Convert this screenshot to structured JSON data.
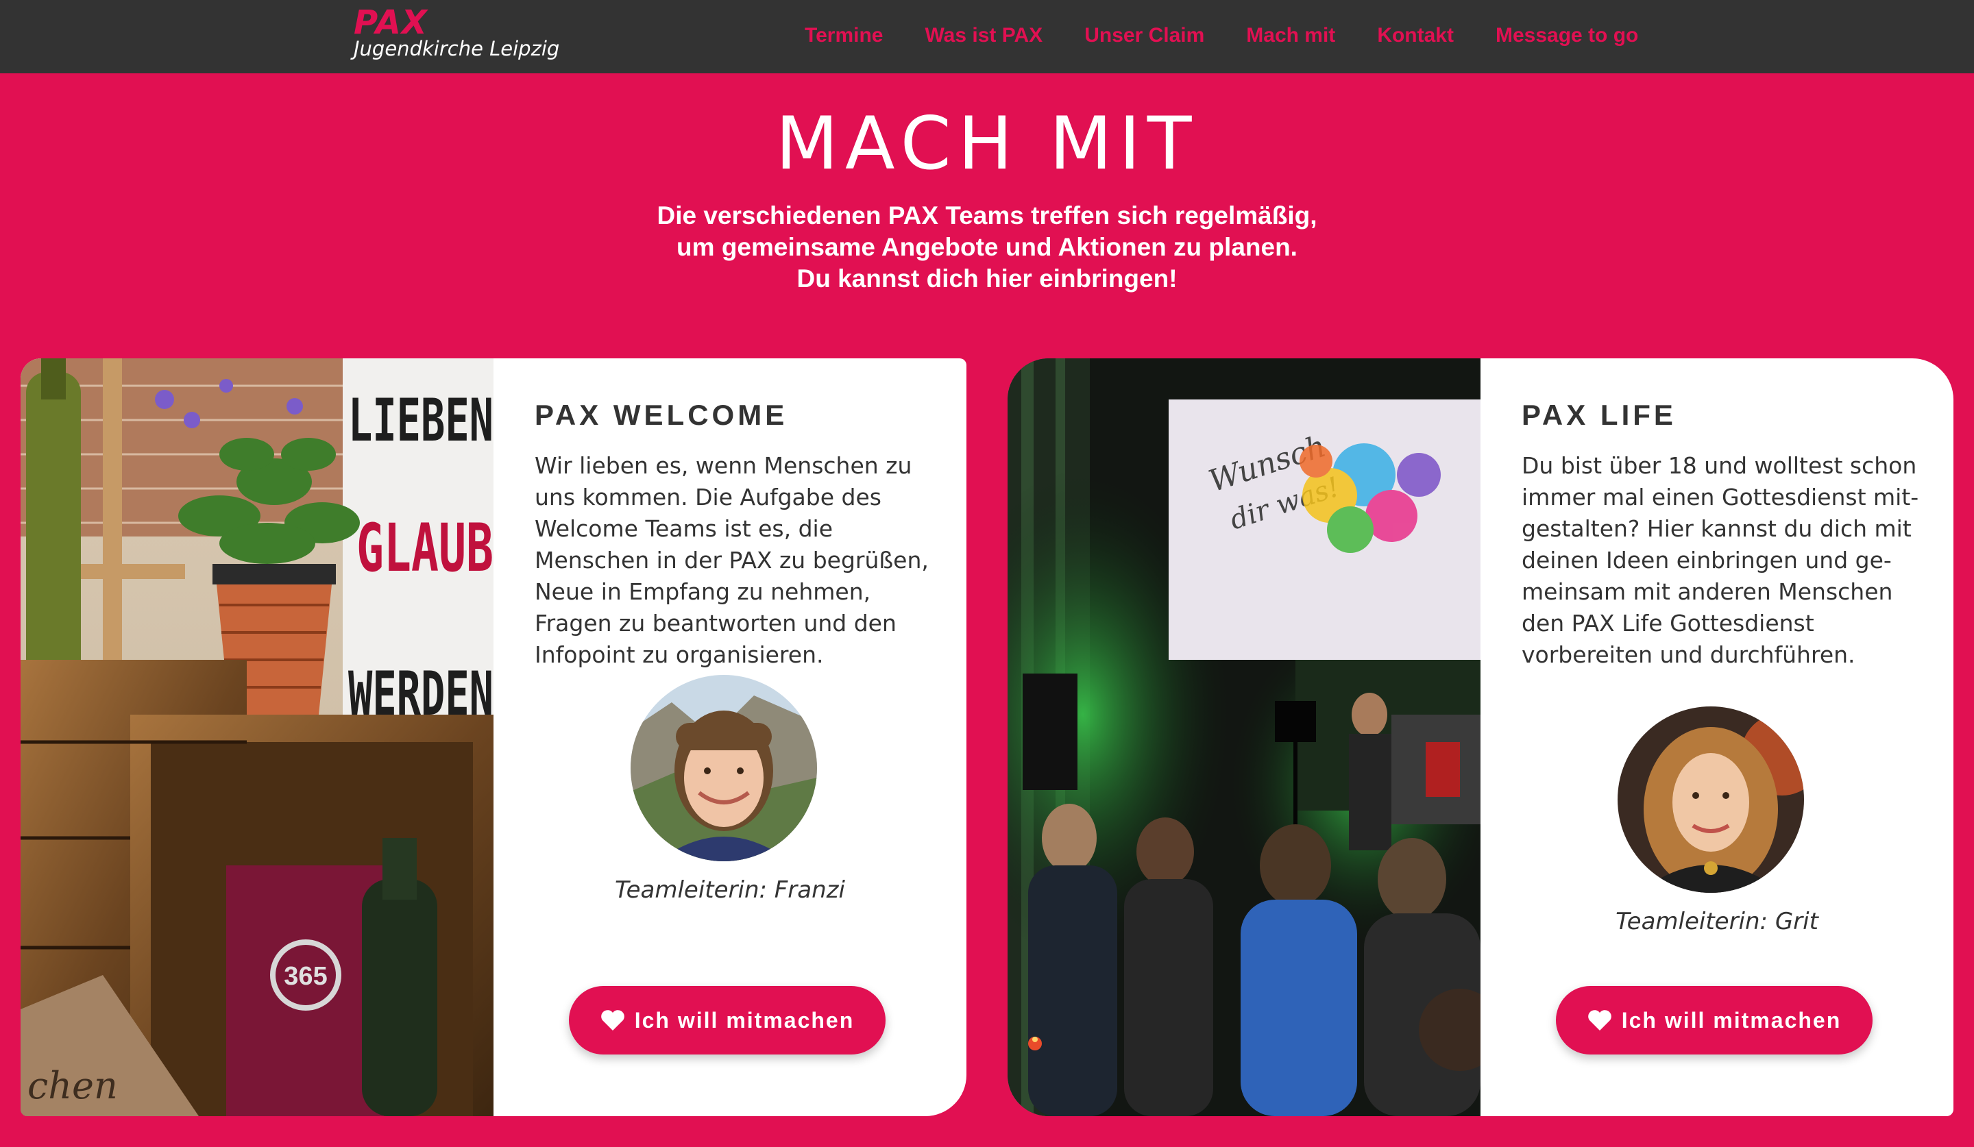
{
  "header": {
    "logo_mark": "PAX",
    "logo_subtitle": "Jugendkirche Leipzig",
    "nav": [
      {
        "label": "Termine"
      },
      {
        "label": "Was ist PAX"
      },
      {
        "label": "Unser Claim"
      },
      {
        "label": "Mach mit"
      },
      {
        "label": "Kontakt"
      },
      {
        "label": "Message to go"
      }
    ]
  },
  "hero": {
    "title": "MACH MIT",
    "lines": [
      "Die verschiedenen PAX Teams treffen sich regelmäßig,",
      "um gemeinsame Angebote und Aktionen zu planen.",
      "Du kannst dich hier einbringen!"
    ]
  },
  "cards": [
    {
      "title": "PAX WELCOME",
      "description": "Wir lieben es, wenn Menschen zu uns kommen. Die Aufgabe des Welcome Teams ist es, die Menschen in der PAX zu begrüßen, Neue in Empfang zu nehmen, Fragen zu beantworten und den Infopoint zu organisieren.",
      "leader": "Teamleiterin: Franzi",
      "button": "Ich will mitmachen",
      "photo": {
        "lightbox_words": [
          "LIEBEN",
          "GLAUB",
          "WERDEN"
        ],
        "box_number": "365",
        "label_text": "chen"
      }
    },
    {
      "title": "PAX LIFE",
      "description": "Du bist über 18 und wolltest schon immer mal einen Gottesdienst mit-gestalten? Hier kannst du dich mit deinen Ideen einbringen und ge-meinsam mit anderen Menschen den PAX Life Gottesdienst vorbereiten und durchführen.",
      "leader": "Teamleiterin: Grit",
      "button": "Ich will mitmachen",
      "photo": {
        "screen_line1": "Wunsch",
        "screen_line2": "dir was!"
      }
    }
  ],
  "colors": {
    "brand": "#e11052",
    "nav_bg": "#333333",
    "text": "#333333"
  }
}
